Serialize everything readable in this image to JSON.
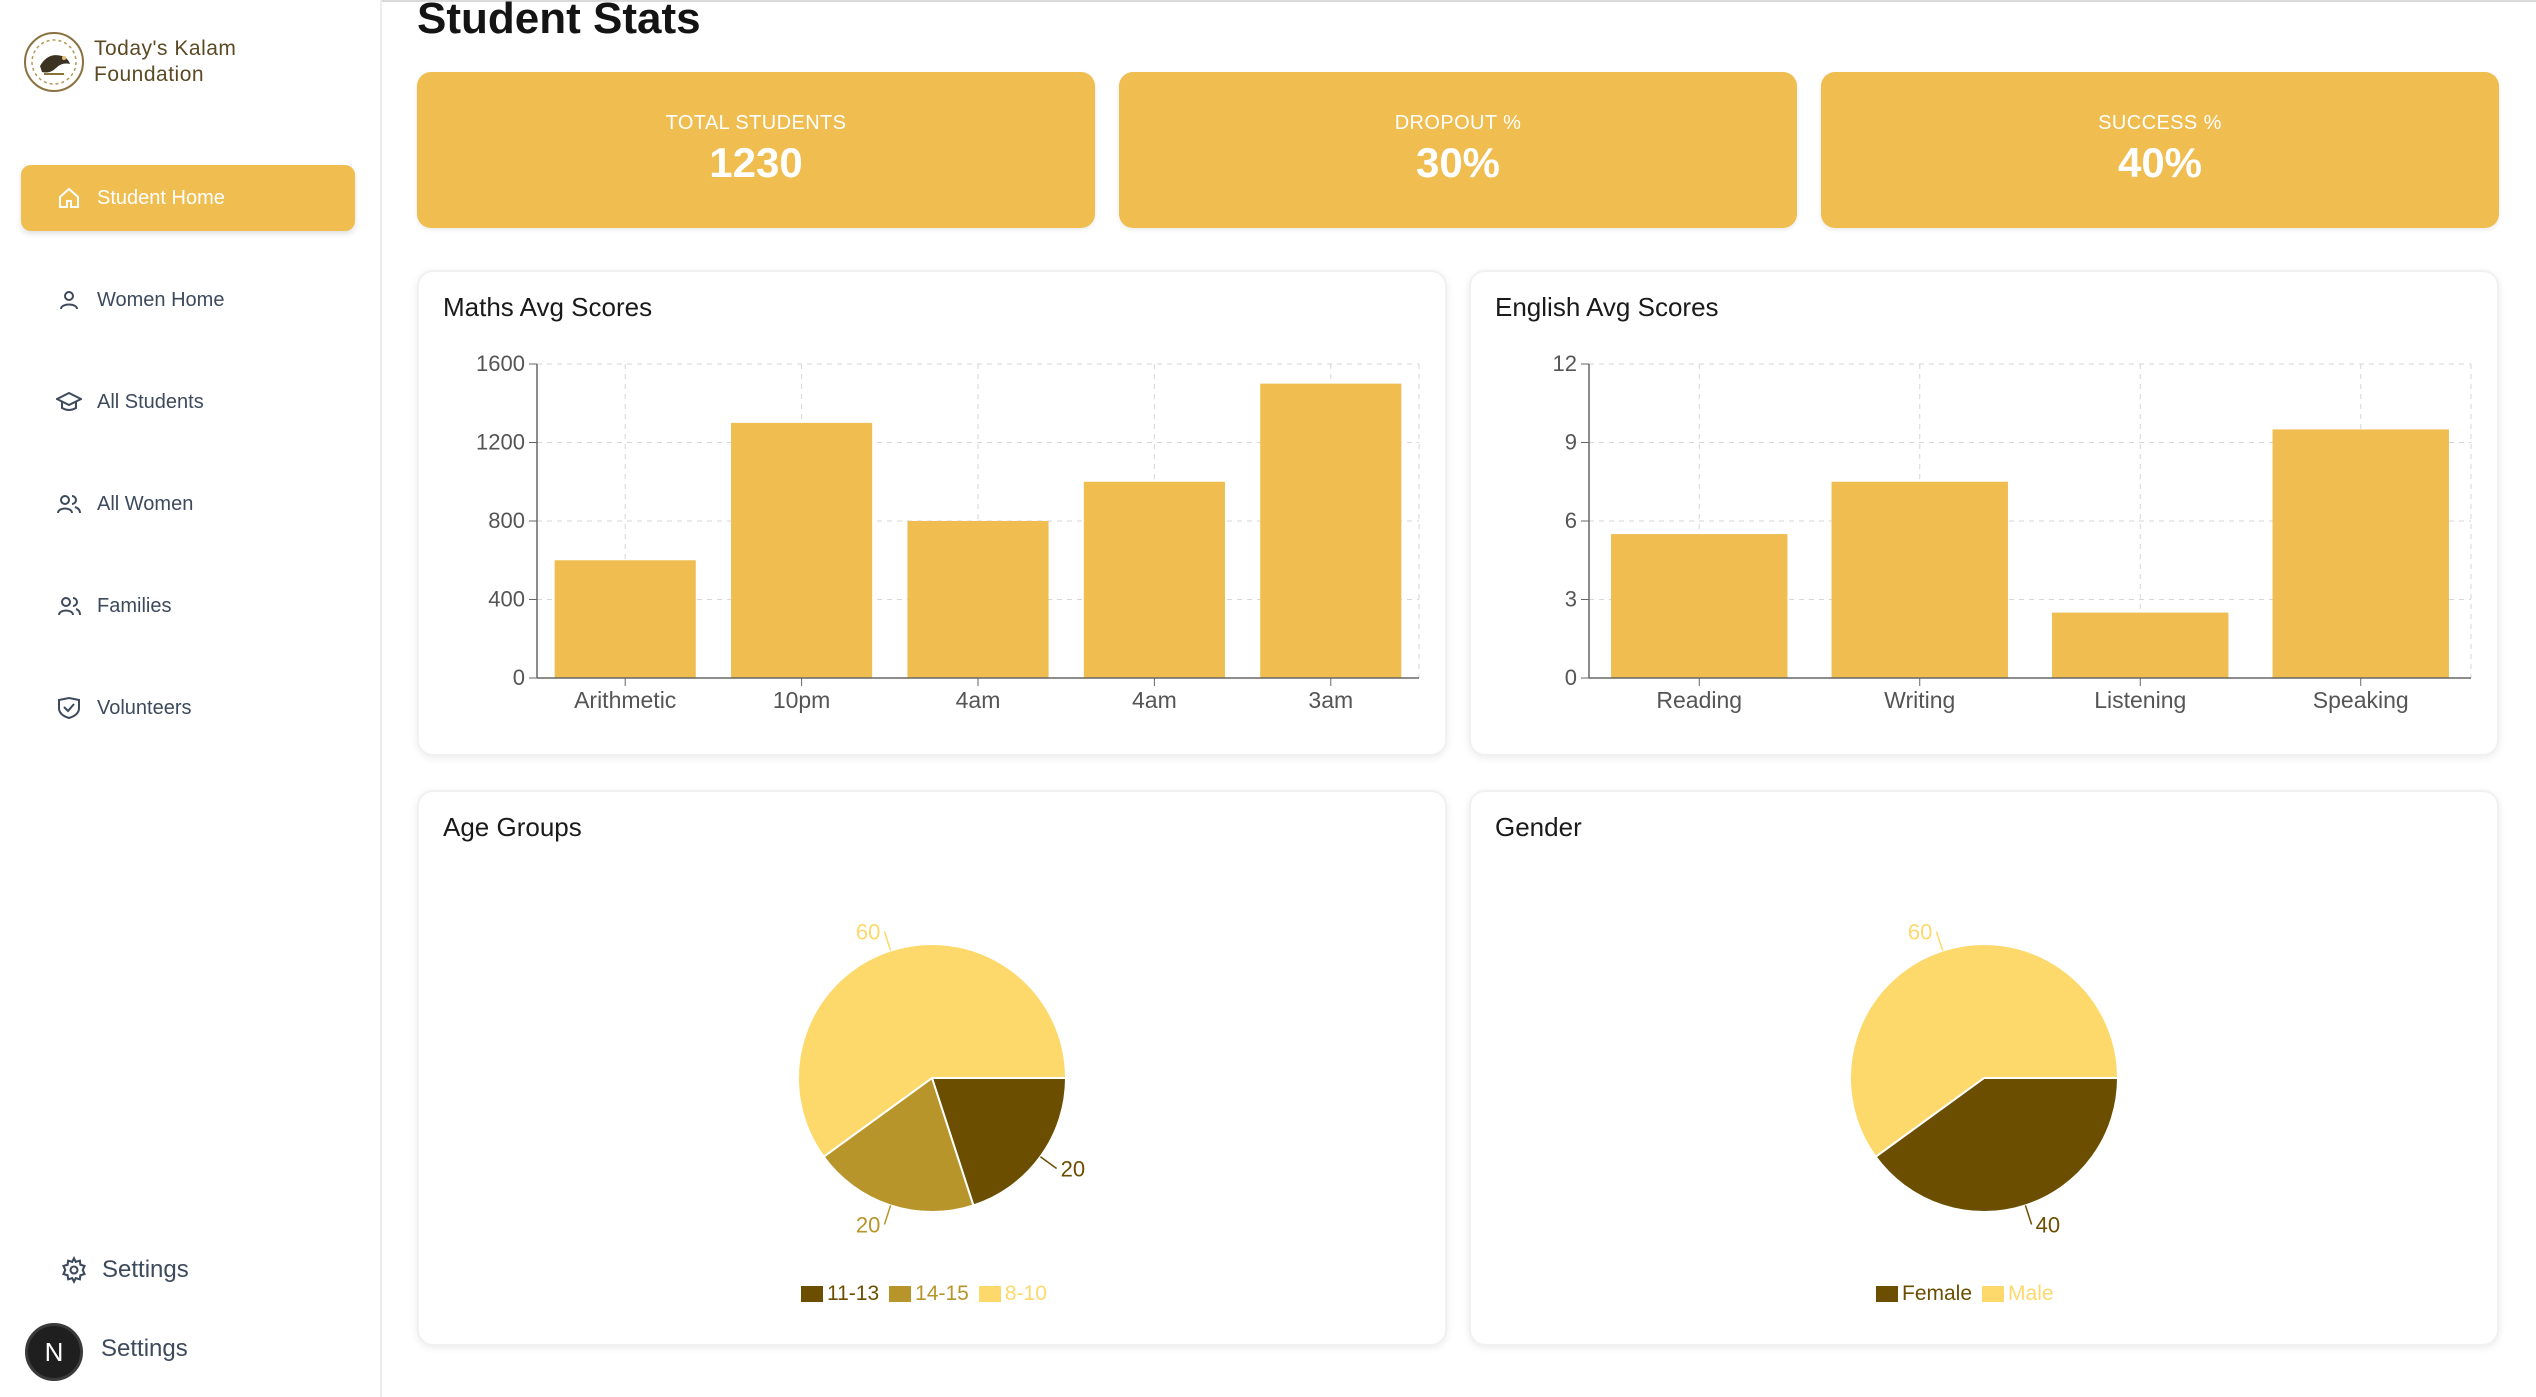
{
  "sidebar": {
    "brand": [
      "Today's Kalam",
      "Foundation"
    ],
    "items": [
      {
        "label": "Student Home",
        "icon": "home-icon",
        "active": true
      },
      {
        "label": "Women Home",
        "icon": "user-icon",
        "active": false
      },
      {
        "label": "All Students",
        "icon": "graduation-cap-icon",
        "active": false
      },
      {
        "label": "All Women",
        "icon": "users-icon",
        "active": false
      },
      {
        "label": "Families",
        "icon": "family-icon",
        "active": false
      },
      {
        "label": "Volunteers",
        "icon": "volunteer-icon",
        "active": false
      }
    ],
    "settings_label": "Settings",
    "account_settings_label": "Settings",
    "avatar_initial": "N"
  },
  "main": {
    "title": "Student Stats",
    "stats": [
      {
        "label": "TOTAL STUDENTS",
        "value": "1230"
      },
      {
        "label": "DROPOUT %",
        "value": "30%"
      },
      {
        "label": "SUCCESS %",
        "value": "40%"
      }
    ],
    "panels": {
      "maths": "Maths Avg Scores",
      "english": "English Avg Scores",
      "age": "Age Groups",
      "gender": "Gender"
    }
  },
  "colors": {
    "accent": "#efbd50",
    "dark": "#6b4e00",
    "mid": "#b8952a",
    "light": "#fdd96c"
  },
  "chart_data": [
    {
      "type": "bar",
      "title": "Maths Avg Scores",
      "categories": [
        "Arithmetic",
        "10pm",
        "4am",
        "4am",
        "3am"
      ],
      "values": [
        600,
        1300,
        800,
        1000,
        1500
      ],
      "ylim": [
        0,
        1600
      ],
      "yticks": [
        0,
        400,
        800,
        1200,
        1600
      ],
      "grid": true
    },
    {
      "type": "bar",
      "title": "English Avg Scores",
      "categories": [
        "Reading",
        "Writing",
        "Listening",
        "Speaking"
      ],
      "values": [
        5.5,
        7.5,
        2.5,
        9.5
      ],
      "ylim": [
        0,
        12
      ],
      "yticks": [
        0,
        3,
        6,
        9,
        12
      ],
      "grid": true
    },
    {
      "type": "pie",
      "title": "Age Groups",
      "slices": [
        {
          "name": "11-13",
          "value": 20
        },
        {
          "name": "14-15",
          "value": 20
        },
        {
          "name": "8-10",
          "value": 60
        }
      ],
      "legend": "bottom"
    },
    {
      "type": "pie",
      "title": "Gender",
      "slices": [
        {
          "name": "Female",
          "value": 40
        },
        {
          "name": "Male",
          "value": 60
        }
      ],
      "legend": "bottom"
    }
  ]
}
